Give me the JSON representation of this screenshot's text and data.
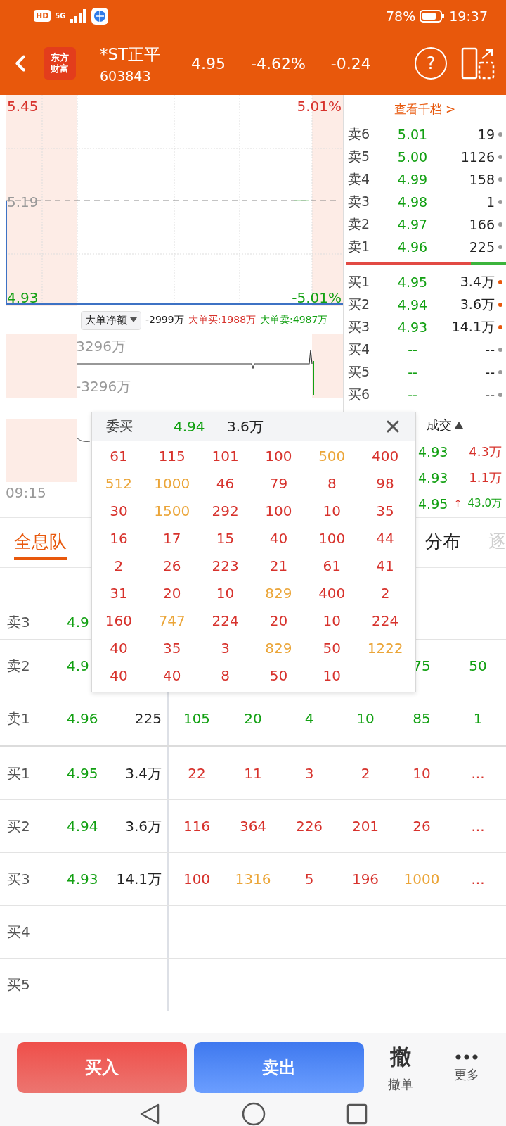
{
  "status_bar": {
    "badges": [
      "HD",
      "5G"
    ],
    "battery": "78%",
    "time": "19:37"
  },
  "header": {
    "logo": [
      "东方",
      "财富"
    ],
    "name": "*ST正平",
    "code": "603843",
    "price": "4.95",
    "change_pct": "-4.62%",
    "change": "-0.24",
    "help": "?"
  },
  "price_chart": {
    "high": "5.45",
    "high_pct": "5.01%",
    "prev_close": "5.19",
    "low": "4.93",
    "low_pct": "-5.01%"
  },
  "big_order": {
    "selector": "大单净额",
    "net": "-2999万",
    "buy": "大单买:1988万",
    "sell": "大单卖:4987万"
  },
  "flow_chart": {
    "top": "3296万",
    "bottom": "-3296万"
  },
  "time_axis": [
    "09:15"
  ],
  "order_book": {
    "link": "查看千档 >",
    "level": 0.78,
    "asks": [
      {
        "label": "卖6",
        "price": "5.01",
        "volume": "19",
        "color": "#9a9a9a"
      },
      {
        "label": "卖5",
        "price": "5.00",
        "volume": "1126",
        "color": "#9a9a9a"
      },
      {
        "label": "卖4",
        "price": "4.99",
        "volume": "158",
        "color": "#9a9a9a"
      },
      {
        "label": "卖3",
        "price": "4.98",
        "volume": "1",
        "color": "#9a9a9a"
      },
      {
        "label": "卖2",
        "price": "4.97",
        "volume": "166",
        "color": "#9a9a9a"
      },
      {
        "label": "卖1",
        "price": "4.96",
        "volume": "225",
        "color": "#9a9a9a"
      }
    ],
    "bids": [
      {
        "label": "买1",
        "price": "4.95",
        "volume": "3.4万",
        "color": "#e8580c"
      },
      {
        "label": "买2",
        "price": "4.94",
        "volume": "3.6万",
        "color": "#e8580c"
      },
      {
        "label": "买3",
        "price": "4.93",
        "volume": "14.1万",
        "color": "#e8580c"
      },
      {
        "label": "买4",
        "price": "--",
        "volume": "--",
        "color": "#9a9a9a"
      },
      {
        "label": "买5",
        "price": "--",
        "volume": "--",
        "color": "#9a9a9a"
      },
      {
        "label": "买6",
        "price": "--",
        "volume": "--",
        "color": "#9a9a9a"
      }
    ]
  },
  "trades": {
    "title": "成交",
    "rows": [
      {
        "price": "4.93",
        "volume": "4.3万",
        "color": "#d7322c"
      },
      {
        "price": "4.93",
        "volume": "1.1万",
        "color": "#d7322c"
      },
      {
        "price": "4.95",
        "arrow": "↑",
        "volume": "43.0万",
        "color": "#12a012"
      }
    ]
  },
  "tabs": [
    {
      "label": "全息队",
      "selected": true,
      "faded": false
    },
    {
      "label": "分布",
      "selected": false,
      "faded": false
    },
    {
      "label": "逐",
      "selected": false,
      "faded": true
    }
  ],
  "queue_table": {
    "rows": [
      {
        "label": "卖3",
        "price": "4.9",
        "kind": "ask"
      },
      {
        "label": "卖2",
        "price": "4.9",
        "kind": "ask",
        "orders": [
          {
            "value": "75",
            "large": false
          },
          {
            "value": "50",
            "large": false
          }
        ]
      },
      {
        "label": "卖1",
        "price": "4.96",
        "volume": "225",
        "kind": "ask",
        "orders": [
          {
            "value": "105",
            "large": false
          },
          {
            "value": "20",
            "large": false
          },
          {
            "value": "4",
            "large": false
          },
          {
            "value": "10",
            "large": false
          },
          {
            "value": "85",
            "large": false
          },
          {
            "value": "1",
            "large": false
          }
        ]
      },
      {
        "label": "买1",
        "price": "4.95",
        "volume": "3.4万",
        "kind": "bid",
        "orders": [
          {
            "value": "22",
            "large": false
          },
          {
            "value": "11",
            "large": false
          },
          {
            "value": "3",
            "large": false
          },
          {
            "value": "2",
            "large": false
          },
          {
            "value": "10",
            "large": false
          },
          {
            "value": "...",
            "large": false
          }
        ]
      },
      {
        "label": "买2",
        "price": "4.94",
        "volume": "3.6万",
        "kind": "bid",
        "orders": [
          {
            "value": "116",
            "large": false
          },
          {
            "value": "364",
            "large": false
          },
          {
            "value": "226",
            "large": false
          },
          {
            "value": "201",
            "large": false
          },
          {
            "value": "26",
            "large": false
          },
          {
            "value": "...",
            "large": false
          }
        ]
      },
      {
        "label": "买3",
        "price": "4.93",
        "volume": "14.1万",
        "kind": "bid",
        "orders": [
          {
            "value": "100",
            "large": false
          },
          {
            "value": "1316",
            "large": true
          },
          {
            "value": "5",
            "large": false
          },
          {
            "value": "196",
            "large": false
          },
          {
            "value": "1000",
            "large": true
          },
          {
            "value": "...",
            "large": false
          }
        ]
      },
      {
        "label": "买4",
        "kind": "bid"
      },
      {
        "label": "买5",
        "kind": "bid"
      }
    ]
  },
  "popup": {
    "title": "委买",
    "price": "4.94",
    "volume": "3.6万",
    "orders": [
      {
        "value": "61",
        "large": false
      },
      {
        "value": "115",
        "large": false
      },
      {
        "value": "101",
        "large": false
      },
      {
        "value": "100",
        "large": false
      },
      {
        "value": "500",
        "large": true
      },
      {
        "value": "400",
        "large": false
      },
      {
        "value": "512",
        "large": true
      },
      {
        "value": "1000",
        "large": true
      },
      {
        "value": "46",
        "large": false
      },
      {
        "value": "79",
        "large": false
      },
      {
        "value": "8",
        "large": false
      },
      {
        "value": "98",
        "large": false
      },
      {
        "value": "30",
        "large": false
      },
      {
        "value": "1500",
        "large": true
      },
      {
        "value": "292",
        "large": false
      },
      {
        "value": "100",
        "large": false
      },
      {
        "value": "10",
        "large": false
      },
      {
        "value": "35",
        "large": false
      },
      {
        "value": "16",
        "large": false
      },
      {
        "value": "17",
        "large": false
      },
      {
        "value": "15",
        "large": false
      },
      {
        "value": "40",
        "large": false
      },
      {
        "value": "100",
        "large": false
      },
      {
        "value": "44",
        "large": false
      },
      {
        "value": "2",
        "large": false
      },
      {
        "value": "26",
        "large": false
      },
      {
        "value": "223",
        "large": false
      },
      {
        "value": "21",
        "large": false
      },
      {
        "value": "61",
        "large": false
      },
      {
        "value": "41",
        "large": false
      },
      {
        "value": "31",
        "large": false
      },
      {
        "value": "20",
        "large": false
      },
      {
        "value": "10",
        "large": false
      },
      {
        "value": "829",
        "large": true
      },
      {
        "value": "400",
        "large": false
      },
      {
        "value": "2",
        "large": false
      },
      {
        "value": "160",
        "large": false
      },
      {
        "value": "747",
        "large": true
      },
      {
        "value": "224",
        "large": false
      },
      {
        "value": "20",
        "large": false
      },
      {
        "value": "10",
        "large": false
      },
      {
        "value": "224",
        "large": false
      },
      {
        "value": "40",
        "large": false
      },
      {
        "value": "35",
        "large": false
      },
      {
        "value": "3",
        "large": false
      },
      {
        "value": "829",
        "large": true
      },
      {
        "value": "50",
        "large": false
      },
      {
        "value": "1222",
        "large": true
      },
      {
        "value": "40",
        "large": false
      },
      {
        "value": "40",
        "large": false
      },
      {
        "value": "8",
        "large": false
      },
      {
        "value": "50",
        "large": false
      },
      {
        "value": "10",
        "large": false
      }
    ]
  },
  "actions": {
    "buy": "买入",
    "sell": "卖出",
    "cancel_glyph": "撤",
    "cancel": "撤单",
    "more": "更多"
  }
}
